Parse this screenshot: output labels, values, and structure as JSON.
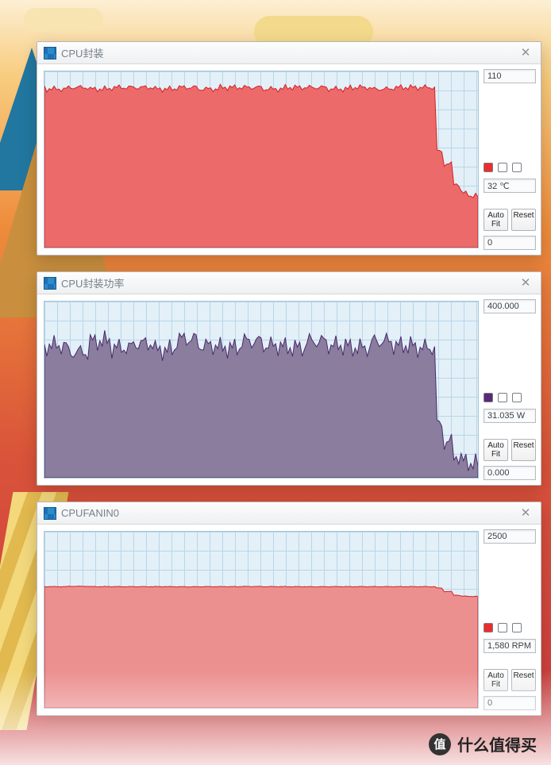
{
  "footer": {
    "badge": "值",
    "text": "什么值得买"
  },
  "windows": [
    {
      "id": "cpu_temp",
      "title": "CPU封装",
      "max": "110",
      "current": "32 ℃",
      "min": "0",
      "autofit": "Auto Fit",
      "reset": "Reset",
      "color": "#ec6a6a",
      "stroke": "#d42323",
      "swatch": "red"
    },
    {
      "id": "cpu_power",
      "title": "CPU封装功率",
      "max": "400.000",
      "current": "31.035 W",
      "min": "0.000",
      "autofit": "Auto Fit",
      "reset": "Reset",
      "color": "#8a7d9d",
      "stroke": "#4a2c6b",
      "swatch": "purple"
    },
    {
      "id": "cpu_fan",
      "title": "CPUFANIN0",
      "max": "2500",
      "current": "1,580 RPM",
      "min": "0",
      "autofit": "Auto Fit",
      "reset": "Reset",
      "color": "#ec8f8f",
      "stroke": "#d42323",
      "swatch": "red"
    }
  ],
  "chart_data": [
    {
      "type": "area",
      "title": "CPU封装",
      "ylabel": "℃",
      "ylim": [
        0,
        110
      ],
      "x": [
        0,
        5,
        10,
        15,
        20,
        25,
        30,
        35,
        40,
        45,
        50,
        55,
        60,
        65,
        70,
        75,
        80,
        85,
        90,
        92,
        94,
        96,
        98,
        100
      ],
      "values": [
        100,
        99,
        100,
        99,
        100,
        100,
        99,
        100,
        99,
        100,
        100,
        99,
        100,
        100,
        99,
        100,
        99,
        100,
        100,
        60,
        52,
        40,
        34,
        32
      ]
    },
    {
      "type": "area",
      "title": "CPU封装功率",
      "ylabel": "W",
      "ylim": [
        0,
        400
      ],
      "x": [
        0,
        5,
        10,
        15,
        20,
        25,
        30,
        35,
        40,
        45,
        50,
        55,
        60,
        65,
        70,
        75,
        80,
        85,
        90,
        92,
        94,
        96,
        98,
        100
      ],
      "values": [
        290,
        300,
        285,
        310,
        295,
        305,
        290,
        315,
        300,
        295,
        310,
        300,
        295,
        310,
        300,
        295,
        310,
        300,
        295,
        120,
        80,
        50,
        38,
        31
      ]
    },
    {
      "type": "area",
      "title": "CPUFANIN0",
      "ylabel": "RPM",
      "ylim": [
        0,
        2500
      ],
      "x": [
        0,
        5,
        10,
        15,
        20,
        25,
        30,
        35,
        40,
        45,
        50,
        55,
        60,
        65,
        70,
        75,
        80,
        85,
        90,
        92,
        94,
        96,
        98,
        100
      ],
      "values": [
        1720,
        1720,
        1725,
        1720,
        1720,
        1720,
        1720,
        1718,
        1720,
        1720,
        1722,
        1720,
        1720,
        1719,
        1720,
        1720,
        1720,
        1720,
        1720,
        1700,
        1650,
        1600,
        1585,
        1580
      ]
    }
  ]
}
